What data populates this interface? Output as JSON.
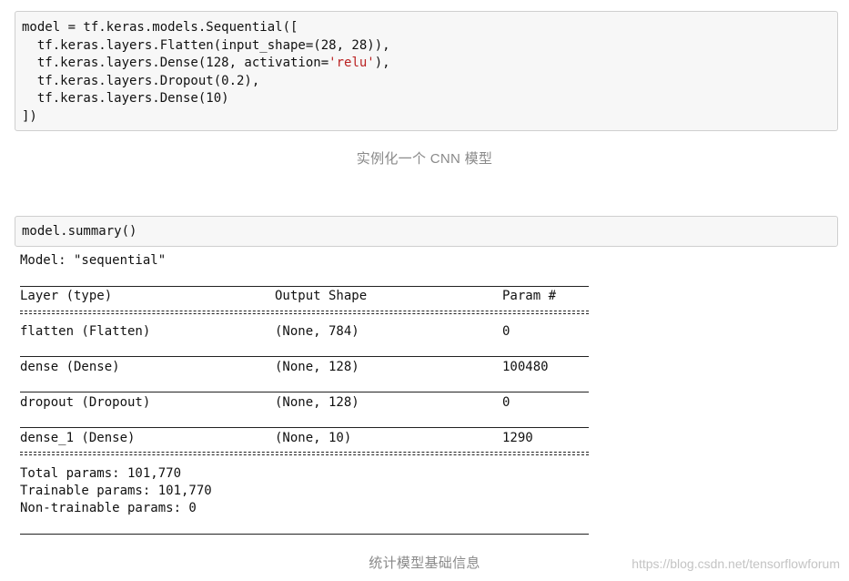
{
  "code_cell_1": {
    "lines": [
      "model = tf.keras.models.Sequential([",
      "  tf.keras.layers.Flatten(input_shape=(28, 28)),",
      "  tf.keras.layers.Dense(128, activation=",
      "'relu'",
      "),",
      "  tf.keras.layers.Dropout(0.2),",
      "  tf.keras.layers.Dense(10)",
      "])"
    ]
  },
  "caption_1": "实例化一个 CNN 模型",
  "code_cell_2": {
    "code": "model.summary()"
  },
  "output": {
    "model_line": "Model: \"sequential\"",
    "headers": [
      "Layer (type)",
      "Output Shape",
      "Param #"
    ],
    "rows": [
      [
        "flatten (Flatten)",
        "(None, 784)",
        "0"
      ],
      [
        "dense (Dense)",
        "(None, 128)",
        "100480"
      ],
      [
        "dropout (Dropout)",
        "(None, 128)",
        "0"
      ],
      [
        "dense_1 (Dense)",
        "(None, 10)",
        "1290"
      ]
    ],
    "total_params": "Total params: 101,770",
    "trainable_params": "Trainable params: 101,770",
    "non_trainable_params": "Non-trainable params: 0"
  },
  "caption_2": "统计模型基础信息",
  "watermark": "https://blog.csdn.net/tensorflowforum"
}
